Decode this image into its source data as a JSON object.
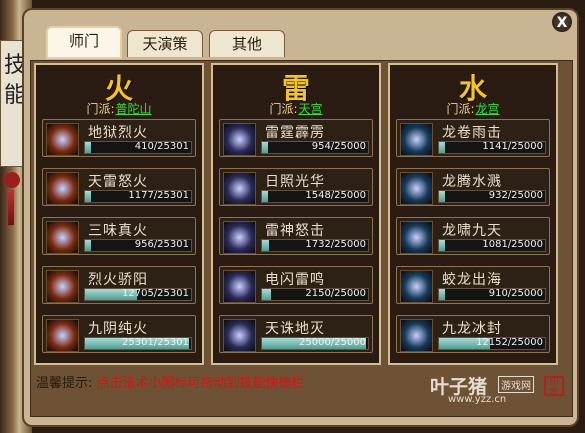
{
  "side_scroll": {
    "text": "技能"
  },
  "window": {
    "close_label": "X"
  },
  "tabs": [
    {
      "label": "师门"
    },
    {
      "label": "天演策"
    },
    {
      "label": "其他"
    }
  ],
  "columns": [
    {
      "element": "火",
      "sect_label": "门派:",
      "sect_name": "普陀山",
      "skills": [
        {
          "name": "地狱烈火",
          "progress": "410/25301",
          "fraction": 0.016
        },
        {
          "name": "天雷怒火",
          "progress": "1177/25301",
          "fraction": 0.047
        },
        {
          "name": "三味真火",
          "progress": "956/25301",
          "fraction": 0.038
        },
        {
          "name": "烈火骄阳",
          "progress": "12705/25301",
          "fraction": 0.502
        },
        {
          "name": "九阴纯火",
          "progress": "25301/25301",
          "fraction": 1.0
        }
      ]
    },
    {
      "element": "雷",
      "sect_label": "门派:",
      "sect_name": "天宫",
      "skills": [
        {
          "name": "雷霆霹雳",
          "progress": "954/25000",
          "fraction": 0.038
        },
        {
          "name": "日照光华",
          "progress": "1548/25000",
          "fraction": 0.062
        },
        {
          "name": "雷神怒击",
          "progress": "1732/25000",
          "fraction": 0.069
        },
        {
          "name": "电闪雷鸣",
          "progress": "2150/25000",
          "fraction": 0.086
        },
        {
          "name": "天诛地灭",
          "progress": "25000/25000",
          "fraction": 1.0
        }
      ]
    },
    {
      "element": "水",
      "sect_label": "门派:",
      "sect_name": "龙宫",
      "skills": [
        {
          "name": "龙卷雨击",
          "progress": "1141/25000",
          "fraction": 0.046
        },
        {
          "name": "龙腾水溅",
          "progress": "932/25000",
          "fraction": 0.037
        },
        {
          "name": "龙啸九天",
          "progress": "1081/25000",
          "fraction": 0.043
        },
        {
          "name": "蛟龙出海",
          "progress": "910/25000",
          "fraction": 0.036
        },
        {
          "name": "九龙冰封",
          "progress": "12152/25000",
          "fraction": 0.486
        }
      ]
    }
  ],
  "hint": {
    "label": "温馨提示:",
    "text": "点击法术小图标可拖动到技能快捷栏"
  },
  "watermark": {
    "brand": "叶子猪",
    "badge": "游戏网",
    "url": "www.yzz.cn",
    "seal": "印章"
  },
  "colors": {
    "fire_icon": "#7a2a10",
    "thunder_icon": "#2a2a5a",
    "water_icon": "#153a5a",
    "bar_fill": "#6fbab0",
    "sect_link": "#30e040",
    "hint_text": "#e01010"
  }
}
